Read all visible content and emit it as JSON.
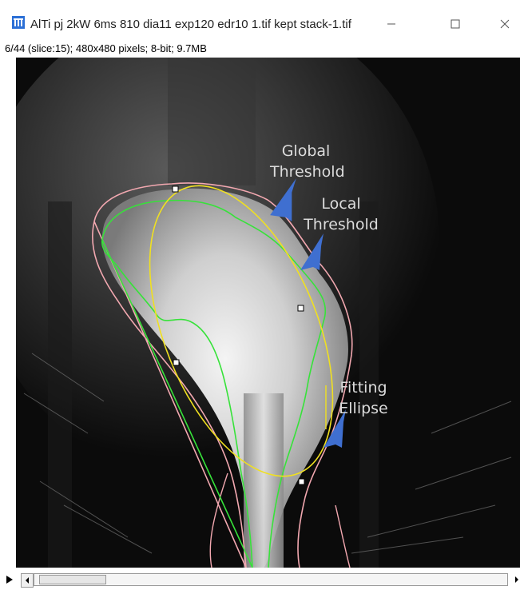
{
  "window": {
    "title": "AlTi pj 2kW 6ms 810 dia11 exp120 edr10 1.tif kept stack-1.tif",
    "minimize_icon": "minimize-icon",
    "maximize_icon": "maximize-icon",
    "close_icon": "close-icon"
  },
  "image_info": "6/44 (slice:15); 480x480 pixels; 8-bit; 9.7MB",
  "annotations": {
    "global_threshold": [
      "Global",
      "Threshold"
    ],
    "local_threshold": [
      "Local",
      "Threshold"
    ],
    "fitting_ellipse": [
      "Fitting",
      "Ellipse"
    ]
  },
  "colors": {
    "global_contour": "#f2a8b0",
    "local_contour": "#37e23a",
    "ellipse": "#f0e020",
    "arrow": "#3f6fd0",
    "background": "#0b0b0b"
  },
  "slice": {
    "current": 6,
    "total": 44
  }
}
